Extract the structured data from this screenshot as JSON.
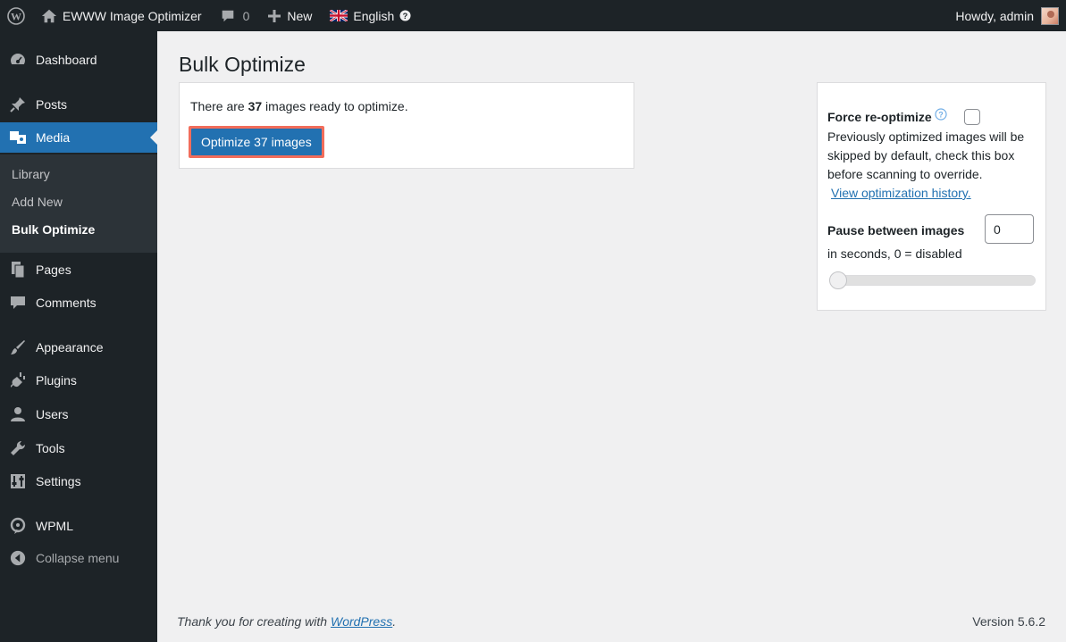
{
  "adminbar": {
    "site_name": "EWWW Image Optimizer",
    "comment_count": "0",
    "new_label": "New",
    "language_label": "English",
    "greeting": "Howdy, admin"
  },
  "sidebar": {
    "items": [
      {
        "label": "Dashboard",
        "icon": "dashboard-icon"
      },
      {
        "label": "Posts",
        "icon": "pin-icon"
      },
      {
        "label": "Media",
        "icon": "media-icon"
      },
      {
        "label": "Pages",
        "icon": "pages-icon"
      },
      {
        "label": "Comments",
        "icon": "comments-icon"
      },
      {
        "label": "Appearance",
        "icon": "brush-icon"
      },
      {
        "label": "Plugins",
        "icon": "plug-icon"
      },
      {
        "label": "Users",
        "icon": "users-icon"
      },
      {
        "label": "Tools",
        "icon": "wrench-icon"
      },
      {
        "label": "Settings",
        "icon": "settings-icon"
      },
      {
        "label": "WPML",
        "icon": "wpml-icon"
      }
    ],
    "media_submenu": [
      "Library",
      "Add New",
      "Bulk Optimize"
    ],
    "collapse_label": "Collapse menu"
  },
  "main": {
    "page_title": "Bulk Optimize",
    "ready_prefix": "There are ",
    "ready_count": "37",
    "ready_suffix": " images ready to optimize.",
    "optimize_button": "Optimize 37 images"
  },
  "options": {
    "force_title": "Force re-optimize",
    "force_desc": " Previously optimized images will be skipped by default, check this box before scanning to override.",
    "history_link": "View optimization history.",
    "pause_title": "Pause between images",
    "pause_value": "0",
    "pause_hint": "in seconds, 0 = disabled",
    "force_checked": false,
    "slider_value": 0
  },
  "footer": {
    "thanks_prefix": "Thank you for creating with ",
    "thanks_link": "WordPress",
    "thanks_suffix": ".",
    "version": "Version 5.6.2"
  },
  "colors": {
    "adminbar_bg": "#1d2327",
    "accent": "#2271b1",
    "highlight_border": "#f26d5b"
  }
}
